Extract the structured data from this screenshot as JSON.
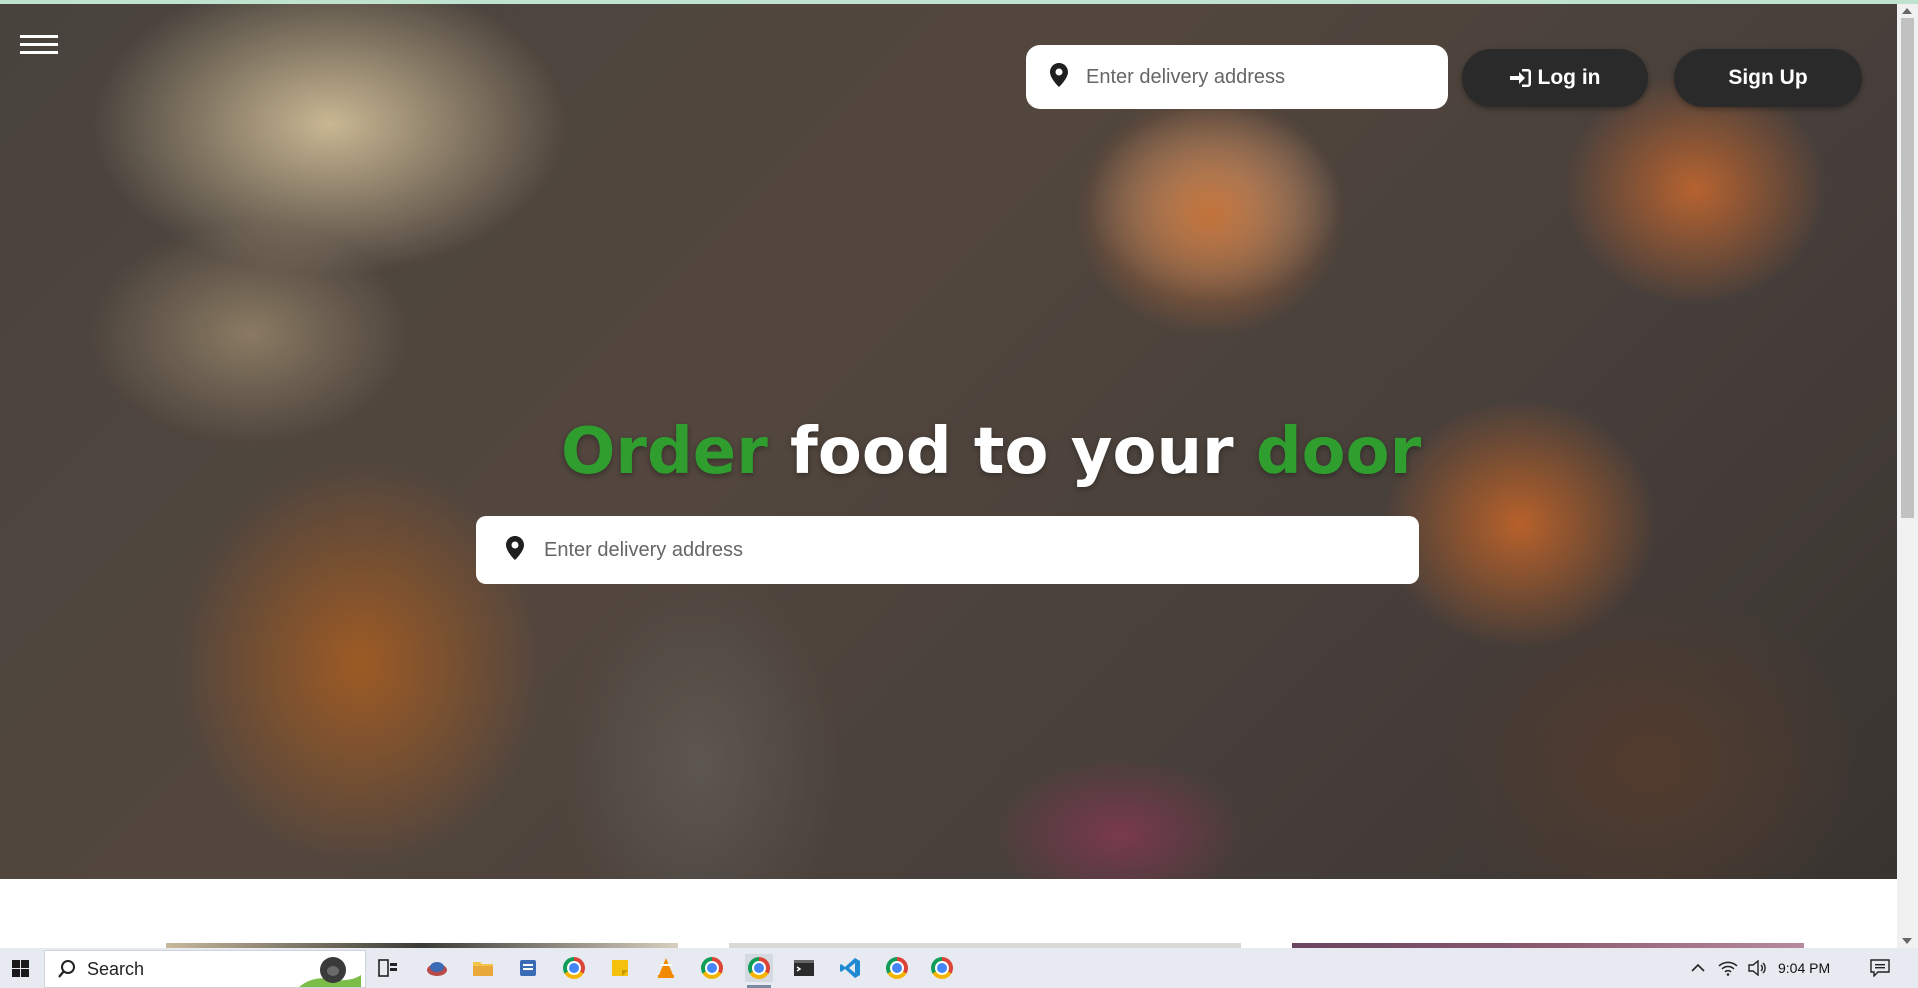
{
  "header": {
    "search_placeholder": "Enter delivery address",
    "login_label": "Log in",
    "signup_label": "Sign Up"
  },
  "hero": {
    "headline_word1": "Order",
    "headline_middle": " food to your ",
    "headline_word2": "door",
    "search_placeholder": "Enter delivery address",
    "accent_color": "#2f9e2f"
  },
  "taskbar": {
    "search_label": "Search",
    "clock": "9:04 PM",
    "icons": [
      "start-icon",
      "search-icon",
      "task-view-icon",
      "file-explorer-icon",
      "chrome-icon",
      "vlc-icon",
      "terminal-icon",
      "vscode-icon",
      "notifications-icon"
    ]
  }
}
